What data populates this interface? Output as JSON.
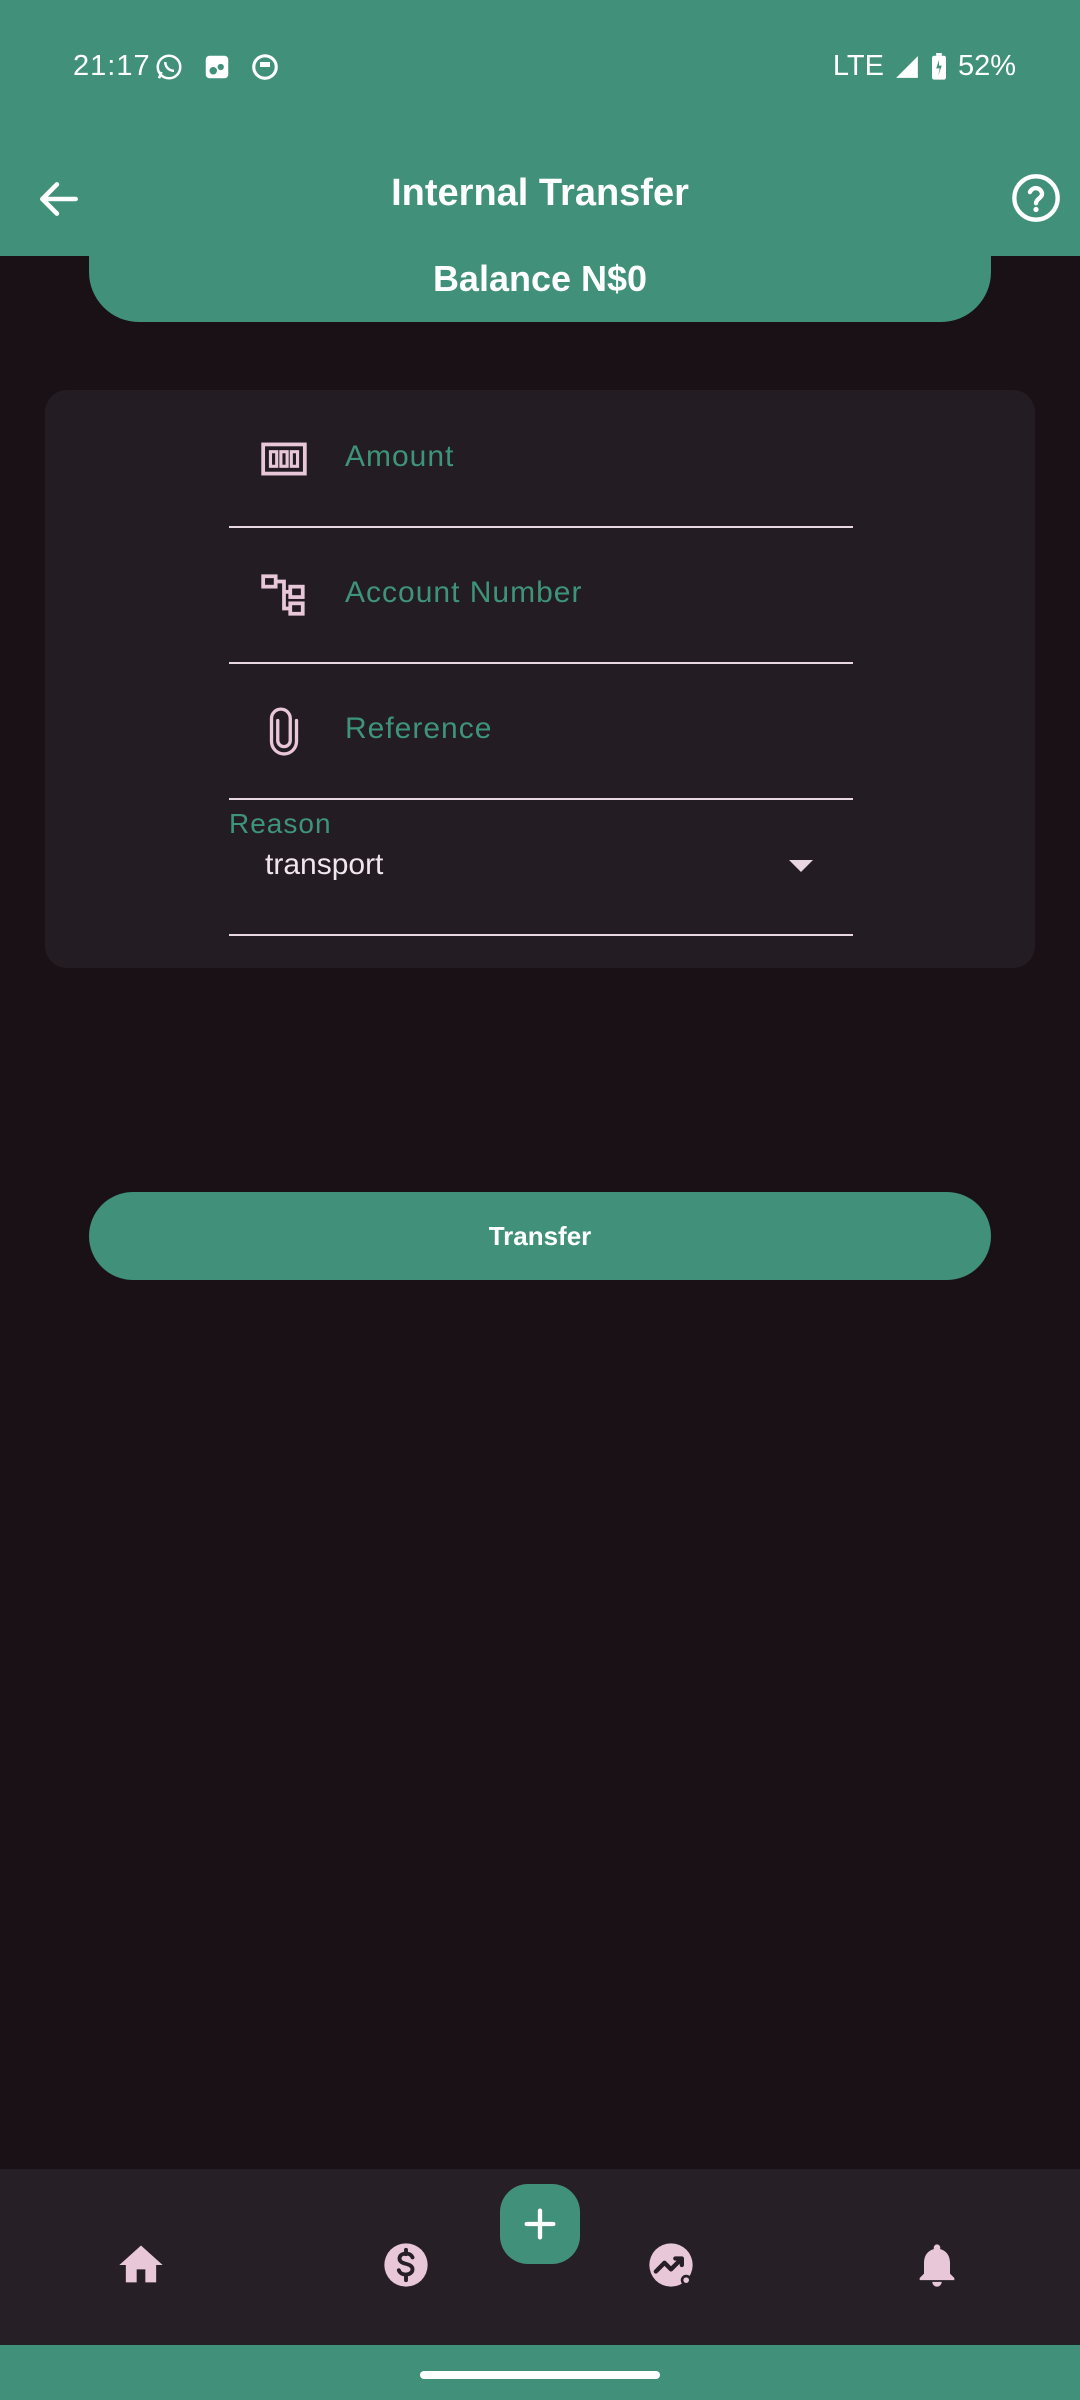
{
  "status_bar": {
    "time": "21:17",
    "network": "LTE",
    "battery": "52%"
  },
  "app_bar": {
    "title": "Internal Transfer"
  },
  "balance": {
    "text": "Balance N$0"
  },
  "form": {
    "amount": {
      "label": "Amount",
      "icon": "banknote-icon"
    },
    "account_number": {
      "label": "Account Number",
      "icon": "account-tree-icon"
    },
    "reference": {
      "label": "Reference",
      "icon": "paperclip-icon"
    },
    "reason": {
      "label": "Reason",
      "value": "transport"
    }
  },
  "actions": {
    "transfer_label": "Transfer"
  },
  "bottom_nav": {
    "items": [
      {
        "name": "home",
        "icon": "home-icon"
      },
      {
        "name": "payments",
        "icon": "dollar-circle-icon"
      },
      {
        "name": "analytics",
        "icon": "trending-chart-icon"
      },
      {
        "name": "notifications",
        "icon": "bell-icon"
      }
    ],
    "fab_icon": "plus-icon"
  },
  "colors": {
    "primary": "#40907a",
    "background": "#1a1116",
    "card": "#231c22",
    "label": "#3e9479",
    "icon_tint": "#e8c7d8"
  }
}
